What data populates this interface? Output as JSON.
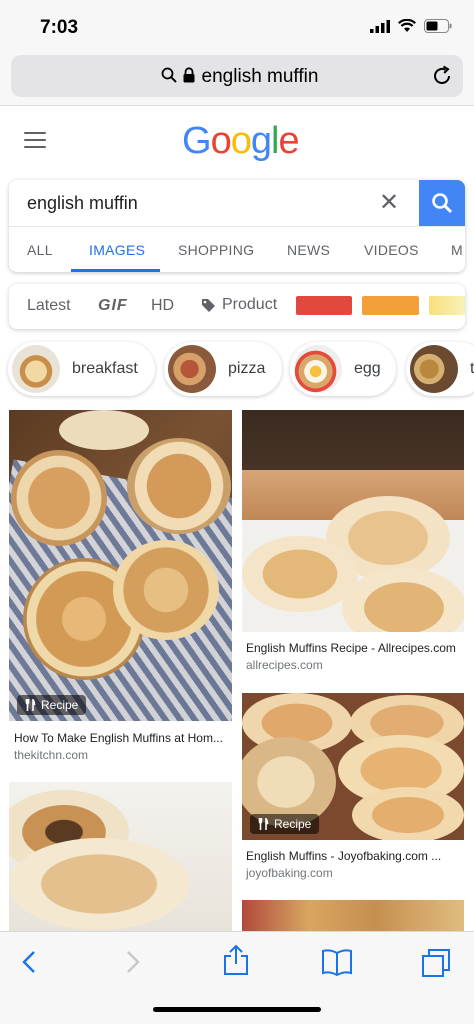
{
  "status": {
    "time": "7:03"
  },
  "browser": {
    "url": "english muffin"
  },
  "google": {
    "logo_letters": [
      {
        "ch": "G",
        "color": "#4285f4"
      },
      {
        "ch": "o",
        "color": "#ea4335"
      },
      {
        "ch": "o",
        "color": "#fbbc05"
      },
      {
        "ch": "g",
        "color": "#4285f4"
      },
      {
        "ch": "l",
        "color": "#34a853"
      },
      {
        "ch": "e",
        "color": "#ea4335"
      }
    ]
  },
  "search": {
    "query": "english muffin",
    "tabs": [
      "ALL",
      "IMAGES",
      "SHOPPING",
      "NEWS",
      "VIDEOS",
      "M"
    ],
    "active_tab": "IMAGES"
  },
  "filters": {
    "items": [
      "Latest",
      "GIF",
      "HD",
      "Product"
    ],
    "color_swatches": [
      "#e2483d",
      "#f2a03a",
      "#f6e07a"
    ]
  },
  "chips": [
    "breakfast",
    "pizza",
    "egg",
    "t"
  ],
  "results": [
    {
      "title": "How To Make English Muffins at Hom...",
      "source": "thekitchn.com",
      "badge": "Recipe"
    },
    {
      "title": "English Muffins Recipe - Allrecipes.com",
      "source": "allrecipes.com",
      "badge": ""
    },
    {
      "title": "English Muffins - Joyofbaking.com ...",
      "source": "joyofbaking.com",
      "badge": "Recipe"
    }
  ],
  "colors": {
    "accent": "#1a73e8",
    "search_button": "#4285f4",
    "ios_blue": "#1a73e8"
  }
}
